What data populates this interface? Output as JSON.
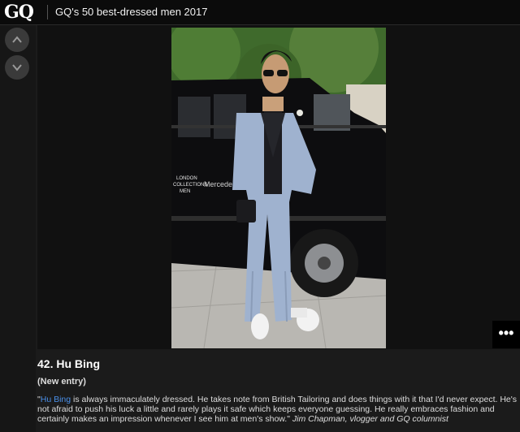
{
  "header": {
    "logo": "GQ",
    "title": "GQ's 50 best-dressed men 2017"
  },
  "nav": {
    "prev_icon": "chevron-up-icon",
    "next_icon": "chevron-down-icon"
  },
  "photo": {
    "car_text_1": "LONDON",
    "car_text_2": "COLLECTIONS",
    "car_text_3": "MEN",
    "car_brand": "Mercedes"
  },
  "menu": {
    "label": "•••"
  },
  "entry": {
    "heading": "42. Hu Bing",
    "status": "(New entry)",
    "quote_open": "\"",
    "name_link": "Hu Bing",
    "quote_text": " is always immaculately dressed. He takes note from British Tailoring and does things with it that I'd never expect. He's not afraid to push his luck a little and rarely plays it safe which keeps everyone guessing. He really embraces fashion and certainly makes an impression whenever I see him at men's show.\" ",
    "attribution": "Jim Chapman, vlogger and GQ columnist"
  },
  "colors": {
    "link": "#4a8fe8",
    "background": "#1b1b1b"
  }
}
